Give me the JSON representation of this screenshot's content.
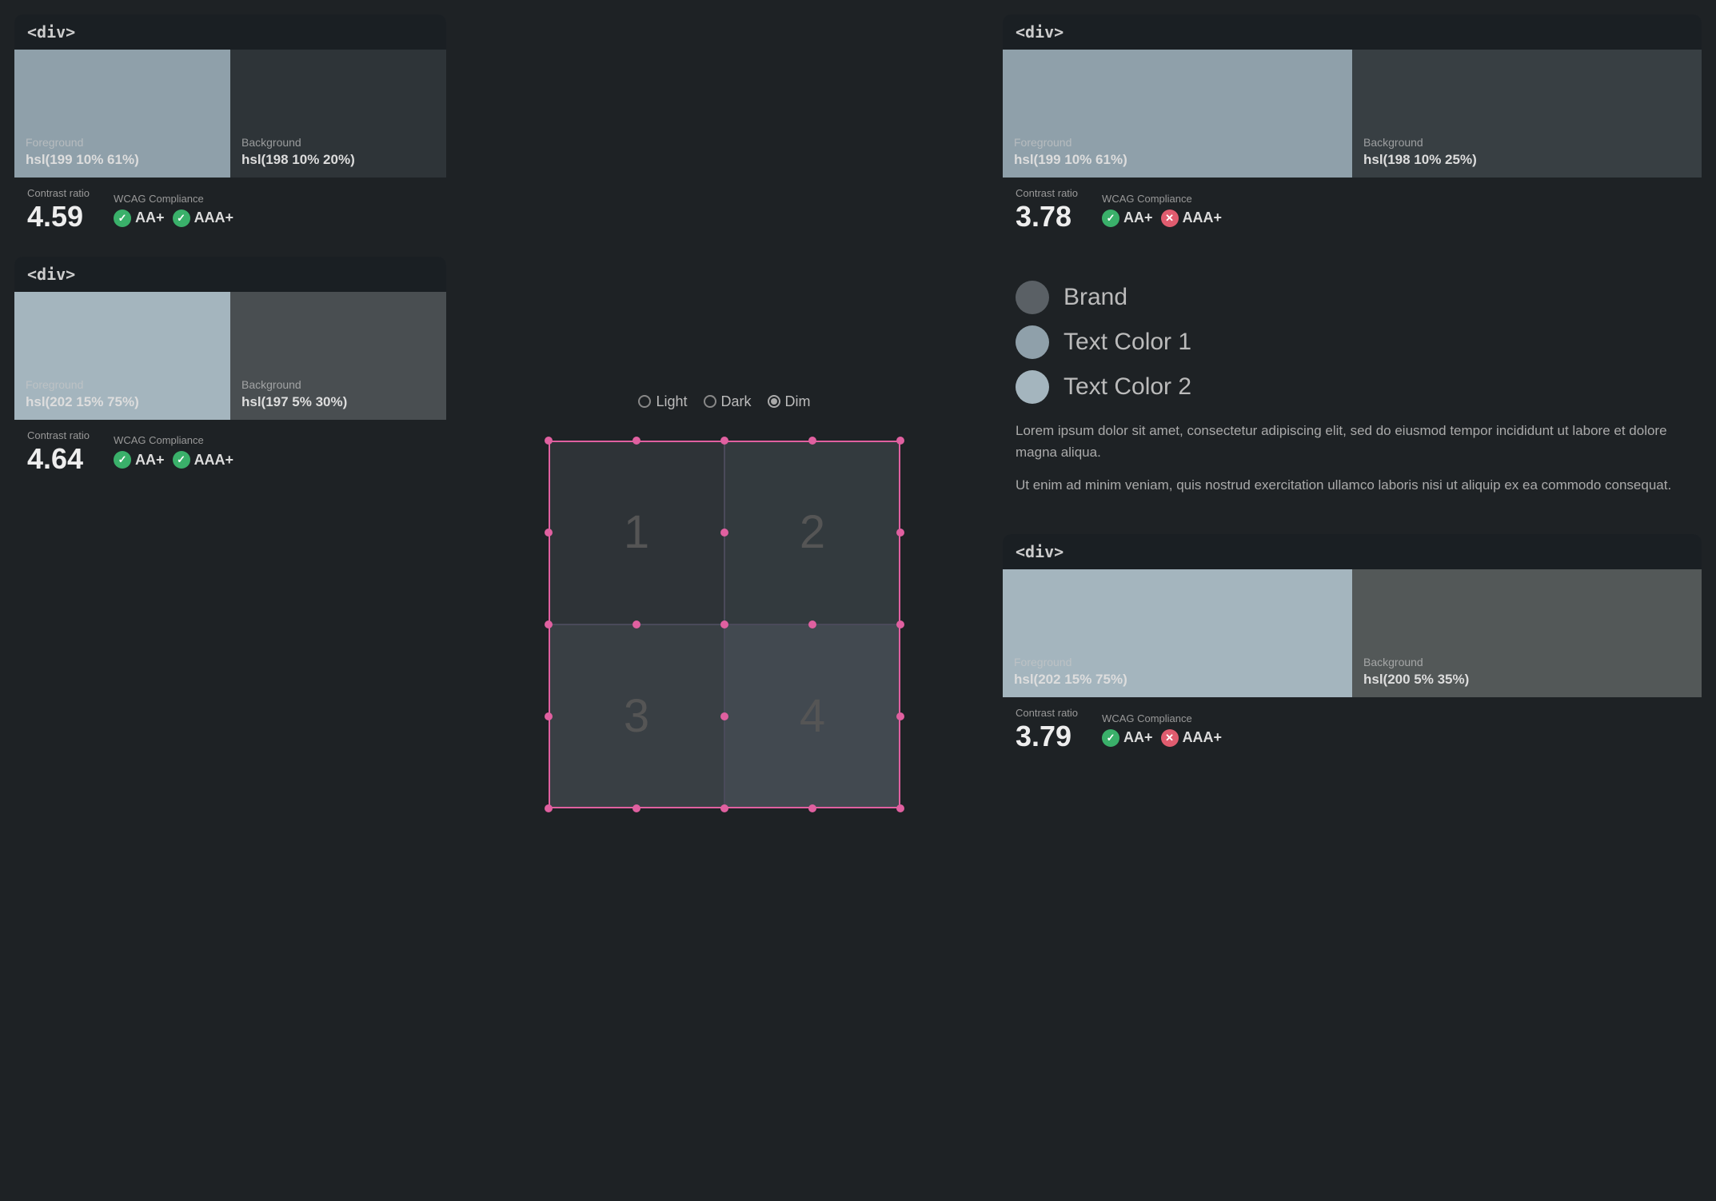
{
  "cards": {
    "topLeft": {
      "tag": "<div>",
      "foreground": {
        "label": "Foreground",
        "value": "hsl(199 10% 61%)",
        "color": "#8fa0aa"
      },
      "background": {
        "label": "Background",
        "value": "hsl(198 10% 20%)",
        "color": "#2e3438"
      },
      "contrastLabel": "Contrast ratio",
      "contrastValue": "4.59",
      "wcagLabel": "WCAG Compliance",
      "badges": [
        {
          "id": "aa-plus",
          "label": "AA+",
          "pass": true
        },
        {
          "id": "aaa-plus",
          "label": "AAA+",
          "pass": true
        }
      ]
    },
    "bottomLeft": {
      "tag": "<div>",
      "foreground": {
        "label": "Foreground",
        "value": "hsl(202 15% 75%)",
        "color": "#a4b5be"
      },
      "background": {
        "label": "Background",
        "value": "hsl(197 5% 30%)",
        "color": "#494e51"
      },
      "contrastLabel": "Contrast ratio",
      "contrastValue": "4.64",
      "wcagLabel": "WCAG Compliance",
      "badges": [
        {
          "id": "aa-plus",
          "label": "AA+",
          "pass": true
        },
        {
          "id": "aaa-plus",
          "label": "AAA+",
          "pass": true
        }
      ]
    },
    "topRight": {
      "tag": "<div>",
      "foreground": {
        "label": "Foreground",
        "value": "hsl(199 10% 61%)",
        "color": "#8fa0aa"
      },
      "background": {
        "label": "Background",
        "value": "hsl(198 10% 25%)",
        "color": "#383f43"
      },
      "contrastLabel": "Contrast ratio",
      "contrastValue": "3.78",
      "wcagLabel": "WCAG Compliance",
      "badges": [
        {
          "id": "aa-plus",
          "label": "AA+",
          "pass": true
        },
        {
          "id": "aaa-plus",
          "label": "AAA+",
          "pass": false
        }
      ]
    },
    "bottomRight": {
      "tag": "<div>",
      "foreground": {
        "label": "Foreground",
        "value": "hsl(202 15% 75%)",
        "color": "#a4b5be"
      },
      "background": {
        "label": "Background",
        "value": "hsl(200 5% 35%)",
        "color": "#535858"
      },
      "contrastLabel": "Contrast ratio",
      "contrastValue": "3.79",
      "wcagLabel": "WCAG Compliance",
      "badges": [
        {
          "id": "aa-plus",
          "label": "AA+",
          "pass": true
        },
        {
          "id": "aaa-plus",
          "label": "AAA+",
          "pass": false
        }
      ]
    }
  },
  "themeSelector": {
    "options": [
      {
        "id": "light",
        "label": "Light",
        "selected": false
      },
      {
        "id": "dark",
        "label": "Dark",
        "selected": false
      },
      {
        "id": "dim",
        "label": "Dim",
        "selected": true
      }
    ]
  },
  "gridCells": [
    "1",
    "2",
    "3",
    "4"
  ],
  "legend": {
    "items": [
      {
        "id": "brand",
        "label": "Brand",
        "color": "#5a6065"
      },
      {
        "id": "text1",
        "label": "Text Color 1",
        "color": "#8fa0aa"
      },
      {
        "id": "text2",
        "label": "Text Color 2",
        "color": "#a4b5be"
      }
    ]
  },
  "bodyText": [
    "Lorem ipsum dolor sit amet, consectetur adipiscing elit, sed do eiusmod tempor incididunt ut labore et dolore magna aliqua.",
    "Ut enim ad minim veniam, quis nostrud exercitation ullamco laboris nisi ut aliquip ex ea commodo consequat."
  ]
}
